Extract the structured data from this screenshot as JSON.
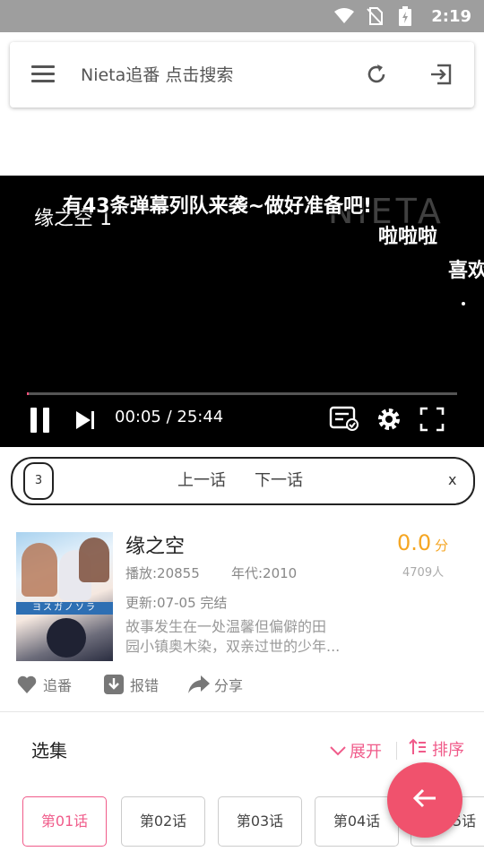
{
  "status_bar": {
    "time": "2:19",
    "icons": [
      "wifi-icon",
      "no-sim-icon",
      "battery-charging-icon"
    ]
  },
  "search": {
    "placeholder": "Nieta追番  点击搜索",
    "icons": [
      "menu-icon",
      "refresh-icon",
      "exit-icon"
    ]
  },
  "player": {
    "episode_title": "缘之空 1",
    "watermark": "NIETA",
    "danmaku": [
      "有43条弹幕列队来袭~做好准备吧!",
      "啦啦啦",
      "喜欢"
    ],
    "current_time": "00:05",
    "total_time": "25:44",
    "time_display": "00:05 / 25:44",
    "progress": 0.003,
    "accent_color": "#ff4f7b"
  },
  "episode_nav": {
    "face": "3",
    "prev_label": "上一话",
    "next_label": "下一话",
    "close_label": "x"
  },
  "anime": {
    "title": "缘之空",
    "cover_text": "ヨスガノソラ",
    "plays_label": "播放:",
    "plays": "20855",
    "year_label": "年代:",
    "year": "2010",
    "plays_line": "播放:20855",
    "year_line": "年代:2010",
    "update_line": "更新:07-05  完结",
    "score": "0.0",
    "score_unit": "分",
    "votes": "4709人",
    "description_line1": "故事发生在一处温馨但偏僻的田",
    "description_line2": "园小镇奥木染，双亲过世的少年..."
  },
  "actions": {
    "follow": "追番",
    "report": "报错",
    "share": "分享"
  },
  "episodes": {
    "title": "选集",
    "expand_label": "展开",
    "sort_label": "排序",
    "items": [
      "第01话",
      "第02话",
      "第03话",
      "第04话",
      "第05话"
    ],
    "active_index": 0,
    "accent_color": "#f05b8a"
  },
  "fab": {
    "icon": "back-arrow-icon",
    "color": "#f0526d"
  }
}
